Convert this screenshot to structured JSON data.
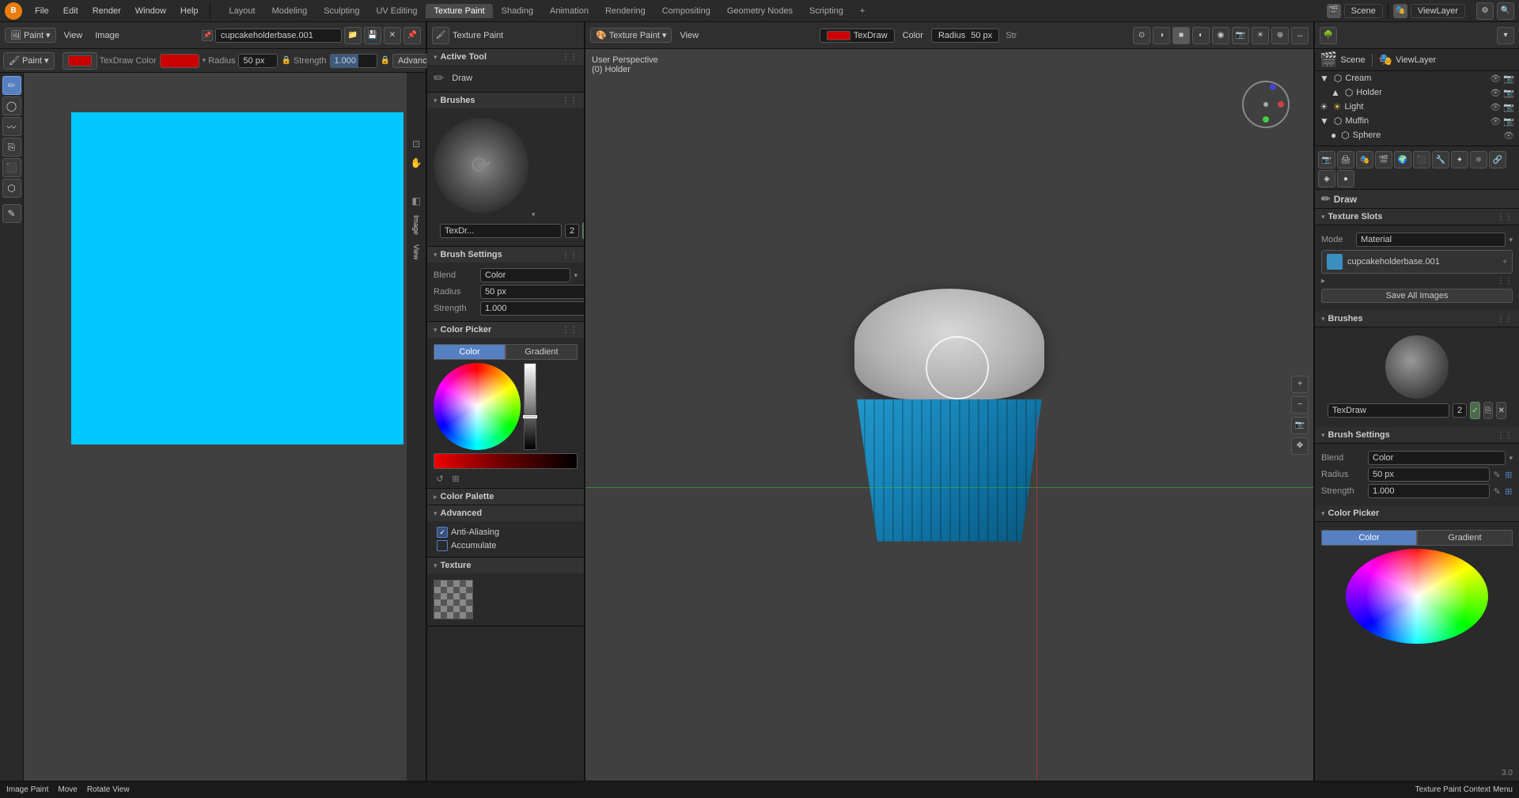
{
  "menu": {
    "logo": "B",
    "items": [
      "File",
      "Edit",
      "Render",
      "Window",
      "Help"
    ],
    "layout_tabs": [
      "Layout",
      "Modeling",
      "Sculpting",
      "UV Editing",
      "Texture Paint",
      "Shading",
      "Animation",
      "Rendering",
      "Compositing",
      "Geometry Nodes",
      "Scripting"
    ],
    "active_tab": "Texture Paint",
    "add_tab": "+",
    "scene_name": "Scene",
    "view_layer": "ViewLayer"
  },
  "left_editor": {
    "type": "Paint",
    "view_label": "View",
    "image_label": "Image",
    "filename": "cupcakeholderbase.001",
    "canvas_bg": "#00c8ff",
    "toolbar": {
      "mode_btn": "Paint",
      "tool_type": "TexDraw",
      "color_label": "Color",
      "radius_label": "Radius",
      "radius_value": "50 px",
      "strength_label": "Strength",
      "strength_value": "1.000",
      "advanced_label": "Advanced"
    },
    "tools": [
      "draw",
      "soften",
      "smear",
      "clone",
      "fill",
      "mask",
      "annotate"
    ]
  },
  "tool_panel": {
    "active_tool": {
      "label": "Active Tool",
      "tool_name": "Draw"
    },
    "brushes": {
      "label": "Brushes",
      "brush_name": "TexDr...",
      "brush_num": "2"
    },
    "brush_settings": {
      "label": "Brush Settings",
      "blend_label": "Blend",
      "blend_value": "Color",
      "radius_label": "Radius",
      "radius_value": "50 px",
      "strength_label": "Strength",
      "strength_value": "1.000"
    },
    "color_picker": {
      "label": "Color Picker",
      "tab_color": "Color",
      "tab_gradient": "Gradient"
    },
    "color_palette": {
      "label": "Color Palette"
    },
    "advanced": {
      "label": "Advanced",
      "anti_aliasing_label": "Anti-Aliasing",
      "anti_aliasing_checked": true,
      "accumulate_label": "Accumulate",
      "accumulate_checked": false
    },
    "texture": {
      "label": "Texture"
    }
  },
  "viewport": {
    "type_label": "Texture Paint",
    "view_label": "View",
    "perspective_label": "User Perspective",
    "object_label": "(0) Holder",
    "mode_label": "TexDraw",
    "radius_label": "Radius",
    "radius_value": "50 px",
    "strength_label": "Str"
  },
  "right_panel": {
    "scene_label": "Scene",
    "view_layer_label": "ViewLayer",
    "draw_label": "Draw",
    "texture_slots": {
      "label": "Texture Slots",
      "mode_label": "Mode",
      "mode_value": "Material",
      "slot_name": "cupcakeholderbase.001",
      "save_all": "Save All Images"
    },
    "brushes_section": {
      "label": "Brushes",
      "brush_name": "TexDraw",
      "brush_num": "2"
    },
    "brush_settings": {
      "label": "Brush Settings",
      "blend_label": "Blend",
      "blend_value": "Color",
      "radius_label": "Radius",
      "radius_value": "50 px",
      "strength_label": "Strength",
      "strength_value": "1.000"
    },
    "color_picker": {
      "label": "Color Picker",
      "tab_color": "Color",
      "tab_gradient": "Gradient"
    }
  },
  "outliner": {
    "objects": [
      {
        "name": "Cream",
        "icon": "▼",
        "type": "mesh"
      },
      {
        "name": "Holder",
        "icon": "▲",
        "type": "mesh"
      },
      {
        "name": "Light",
        "icon": "☀",
        "type": "light"
      },
      {
        "name": "Muffin",
        "icon": "▼",
        "type": "mesh"
      },
      {
        "name": "Sphere",
        "icon": "●",
        "type": "mesh"
      }
    ]
  },
  "status_bar": {
    "image_paint": "Image Paint",
    "move": "Move",
    "rotate_view": "Rotate View",
    "context_menu": "Texture Paint Context Menu",
    "version": "3.0"
  },
  "icons": {
    "cursor": "⊕",
    "move": "✥",
    "brush": "🖌",
    "arrow": "▸",
    "arrow_down": "▾",
    "arrow_right": "▸",
    "eye": "👁",
    "gear": "⚙",
    "search": "🔍",
    "camera": "📷",
    "check": "✓",
    "dots": "⋮⋮",
    "close": "✕"
  }
}
